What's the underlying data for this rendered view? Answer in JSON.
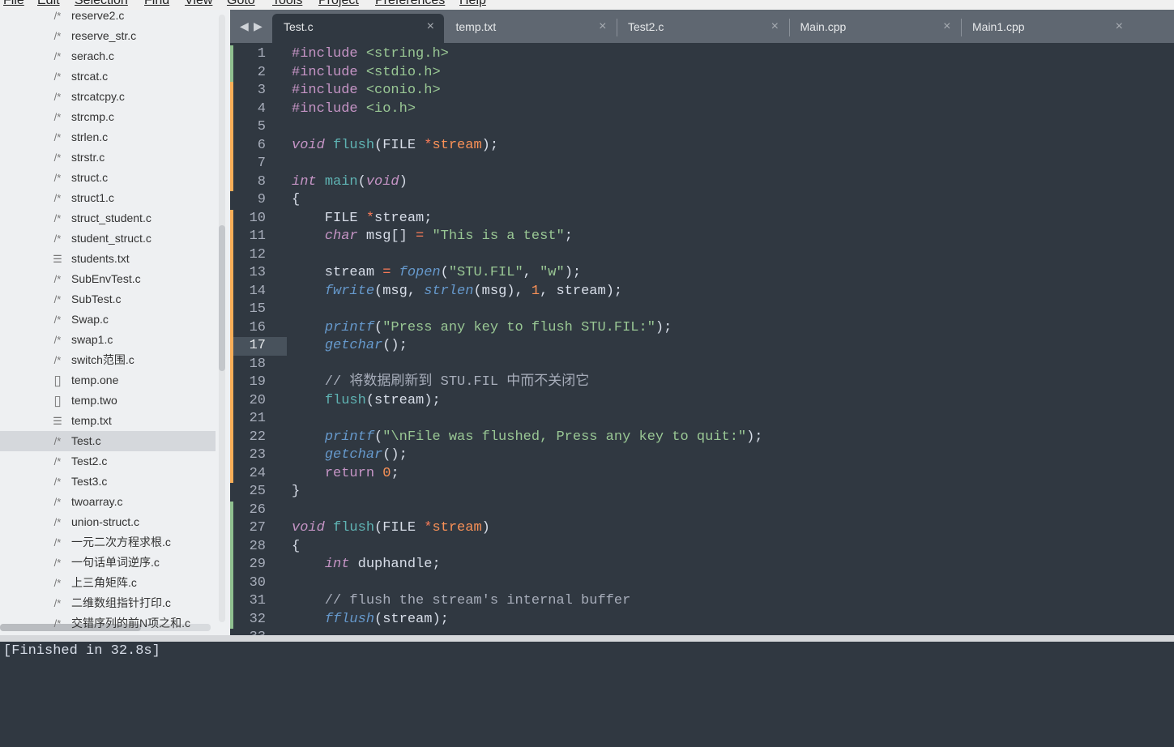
{
  "menu": [
    "File",
    "Edit",
    "Selection",
    "Find",
    "View",
    "Goto",
    "Tools",
    "Project",
    "Preferences",
    "Help"
  ],
  "sidebar": {
    "selected": "Test.c",
    "items": [
      {
        "icon": "c-file-icon",
        "label": "reserve2.c"
      },
      {
        "icon": "c-file-icon",
        "label": "reserve_str.c"
      },
      {
        "icon": "c-file-icon",
        "label": "serach.c"
      },
      {
        "icon": "c-file-icon",
        "label": "strcat.c"
      },
      {
        "icon": "c-file-icon",
        "label": "strcatcpy.c"
      },
      {
        "icon": "c-file-icon",
        "label": "strcmp.c"
      },
      {
        "icon": "c-file-icon",
        "label": "strlen.c"
      },
      {
        "icon": "c-file-icon",
        "label": "strstr.c"
      },
      {
        "icon": "c-file-icon",
        "label": "struct.c"
      },
      {
        "icon": "c-file-icon",
        "label": "struct1.c"
      },
      {
        "icon": "c-file-icon",
        "label": "struct_student.c"
      },
      {
        "icon": "c-file-icon",
        "label": "student_struct.c"
      },
      {
        "icon": "text-file-icon",
        "label": "students.txt"
      },
      {
        "icon": "c-file-icon",
        "label": "SubEnvTest.c"
      },
      {
        "icon": "c-file-icon",
        "label": "SubTest.c"
      },
      {
        "icon": "c-file-icon",
        "label": "Swap.c"
      },
      {
        "icon": "c-file-icon",
        "label": "swap1.c"
      },
      {
        "icon": "c-file-icon",
        "label": "switch范围.c"
      },
      {
        "icon": "document-icon",
        "label": "temp.one"
      },
      {
        "icon": "document-icon",
        "label": "temp.two"
      },
      {
        "icon": "text-file-icon",
        "label": "temp.txt"
      },
      {
        "icon": "c-file-icon",
        "label": "Test.c"
      },
      {
        "icon": "c-file-icon",
        "label": "Test2.c"
      },
      {
        "icon": "c-file-icon",
        "label": "Test3.c"
      },
      {
        "icon": "c-file-icon",
        "label": "twoarray.c"
      },
      {
        "icon": "c-file-icon",
        "label": "union-struct.c"
      },
      {
        "icon": "c-file-icon",
        "label": "一元二次方程求根.c"
      },
      {
        "icon": "c-file-icon",
        "label": "一句话单词逆序.c"
      },
      {
        "icon": "c-file-icon",
        "label": "上三角矩阵.c"
      },
      {
        "icon": "c-file-icon",
        "label": "二维数组指针打印.c"
      },
      {
        "icon": "c-file-icon",
        "label": "交错序列的前N项之和.c"
      }
    ]
  },
  "tabs": [
    {
      "label": "Test.c",
      "active": true
    },
    {
      "label": "temp.txt"
    },
    {
      "label": "Test2.c"
    },
    {
      "label": "Main.cpp"
    },
    {
      "label": "Main1.cpp"
    }
  ],
  "editor": {
    "current_line": 17,
    "gutter_marks": {
      "added": [
        1,
        2,
        26,
        27,
        28,
        29,
        30,
        31,
        32
      ],
      "modified": [
        3,
        4,
        5,
        6,
        7,
        8,
        10,
        11,
        12,
        13,
        14,
        15,
        16,
        17,
        18,
        19,
        20,
        21,
        22,
        23,
        24
      ]
    },
    "marker_colors": {
      "added": "#8fbf8f",
      "modified": "#f9ae58"
    },
    "lines": [
      [
        [
          "kw",
          "#include "
        ],
        [
          "st",
          "<string.h>"
        ]
      ],
      [
        [
          "kw",
          "#include "
        ],
        [
          "st",
          "<stdio.h>"
        ]
      ],
      [
        [
          "kw",
          "#include "
        ],
        [
          "st",
          "<conio.h>"
        ]
      ],
      [
        [
          "kw",
          "#include "
        ],
        [
          "st",
          "<io.h>"
        ]
      ],
      [],
      [
        [
          "kw it",
          "void"
        ],
        [
          "pl",
          " "
        ],
        [
          "fn",
          "flush"
        ],
        [
          "pl",
          "(FILE "
        ],
        [
          "op",
          "*"
        ],
        [
          "pa",
          "stream"
        ],
        [
          "pl",
          ");"
        ]
      ],
      [],
      [
        [
          "kw it",
          "int"
        ],
        [
          "pl",
          " "
        ],
        [
          "fn",
          "main"
        ],
        [
          "pl",
          "("
        ],
        [
          "kw it",
          "void"
        ],
        [
          "pl",
          ")"
        ]
      ],
      [
        [
          "pl",
          "{"
        ]
      ],
      [
        [
          "pl",
          "    FILE "
        ],
        [
          "op",
          "*"
        ],
        [
          "pl",
          "stream;"
        ]
      ],
      [
        [
          "pl",
          "    "
        ],
        [
          "kw it",
          "char"
        ],
        [
          "pl",
          " msg[] "
        ],
        [
          "op",
          "="
        ],
        [
          "pl",
          " "
        ],
        [
          "st",
          "\"This is a test\""
        ],
        [
          "pl",
          ";"
        ]
      ],
      [],
      [
        [
          "pl",
          "    stream "
        ],
        [
          "op",
          "="
        ],
        [
          "pl",
          " "
        ],
        [
          "fi",
          "fopen"
        ],
        [
          "pl",
          "("
        ],
        [
          "st",
          "\"STU.FIL\""
        ],
        [
          "pl",
          ", "
        ],
        [
          "st",
          "\"w\""
        ],
        [
          "pl",
          ");"
        ]
      ],
      [
        [
          "pl",
          "    "
        ],
        [
          "fi",
          "fwrite"
        ],
        [
          "pl",
          "(msg, "
        ],
        [
          "fi",
          "strlen"
        ],
        [
          "pl",
          "(msg), "
        ],
        [
          "nu",
          "1"
        ],
        [
          "pl",
          ", stream);"
        ]
      ],
      [],
      [
        [
          "pl",
          "    "
        ],
        [
          "fi",
          "printf"
        ],
        [
          "pl",
          "("
        ],
        [
          "st",
          "\"Press any key to flush STU.FIL:\""
        ],
        [
          "pl",
          ");"
        ]
      ],
      [
        [
          "pl",
          "    "
        ],
        [
          "fi",
          "getchar"
        ],
        [
          "pl",
          "();"
        ]
      ],
      [],
      [
        [
          "cm",
          "    // 将数据刷新到 STU.FIL 中而不关闭它"
        ]
      ],
      [
        [
          "pl",
          "    "
        ],
        [
          "fn",
          "flush"
        ],
        [
          "pl",
          "(stream);"
        ]
      ],
      [],
      [
        [
          "pl",
          "    "
        ],
        [
          "fi",
          "printf"
        ],
        [
          "pl",
          "("
        ],
        [
          "st",
          "\"\\nFile was flushed, Press any key to quit:\""
        ],
        [
          "pl",
          ");"
        ]
      ],
      [
        [
          "pl",
          "    "
        ],
        [
          "fi",
          "getchar"
        ],
        [
          "pl",
          "();"
        ]
      ],
      [
        [
          "pl",
          "    "
        ],
        [
          "kw",
          "return"
        ],
        [
          "pl",
          " "
        ],
        [
          "nu",
          "0"
        ],
        [
          "pl",
          ";"
        ]
      ],
      [
        [
          "pl",
          "}"
        ]
      ],
      [],
      [
        [
          "kw it",
          "void"
        ],
        [
          "pl",
          " "
        ],
        [
          "fn",
          "flush"
        ],
        [
          "pl",
          "(FILE "
        ],
        [
          "op",
          "*"
        ],
        [
          "pa",
          "stream"
        ],
        [
          "pl",
          ")"
        ]
      ],
      [
        [
          "pl",
          "{"
        ]
      ],
      [
        [
          "pl",
          "    "
        ],
        [
          "kw it",
          "int"
        ],
        [
          "pl",
          " duphandle;"
        ]
      ],
      [],
      [
        [
          "cm",
          "    // flush the stream's internal buffer"
        ]
      ],
      [
        [
          "pl",
          "    "
        ],
        [
          "fi",
          "fflush"
        ],
        [
          "pl",
          "(stream);"
        ]
      ],
      []
    ]
  },
  "console": {
    "text": "[Finished in 32.8s]"
  }
}
